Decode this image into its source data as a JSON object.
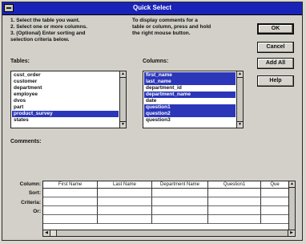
{
  "window": {
    "title": "Quick Select"
  },
  "instructions": [
    "1. Select the table you want.",
    "2. Select one or more columns.",
    "3. (Optional) Enter sorting and",
    "    selection criteria below."
  ],
  "tip": [
    "To display comments for a",
    "table or column, press and hold",
    "the right mouse button."
  ],
  "tables": {
    "label": "Tables:",
    "items": [
      {
        "text": "cust_order",
        "selected": false
      },
      {
        "text": "customer",
        "selected": false
      },
      {
        "text": "department",
        "selected": false
      },
      {
        "text": "employee",
        "selected": false
      },
      {
        "text": "dvos",
        "selected": false
      },
      {
        "text": "part",
        "selected": false
      },
      {
        "text": "product_survey",
        "selected": true
      },
      {
        "text": "states",
        "selected": false
      }
    ]
  },
  "columns": {
    "label": "Columns:",
    "items": [
      {
        "text": "first_name",
        "selected": true
      },
      {
        "text": "last_name",
        "selected": true
      },
      {
        "text": "department_id",
        "selected": false
      },
      {
        "text": "department_name",
        "selected": true
      },
      {
        "text": "date",
        "selected": false
      },
      {
        "text": "question1",
        "selected": true
      },
      {
        "text": "question2",
        "selected": true
      },
      {
        "text": "question3",
        "selected": false
      }
    ]
  },
  "buttons": {
    "ok": "OK",
    "cancel": "Cancel",
    "add_all": "Add All",
    "help": "Help"
  },
  "comments_label": "Comments:",
  "grid": {
    "row_labels": [
      "Column:",
      "Sort:",
      "Criteria:",
      "Or:"
    ],
    "headers": [
      "First Name",
      "Last Name",
      "Department Name",
      "Question1",
      "Que"
    ]
  }
}
